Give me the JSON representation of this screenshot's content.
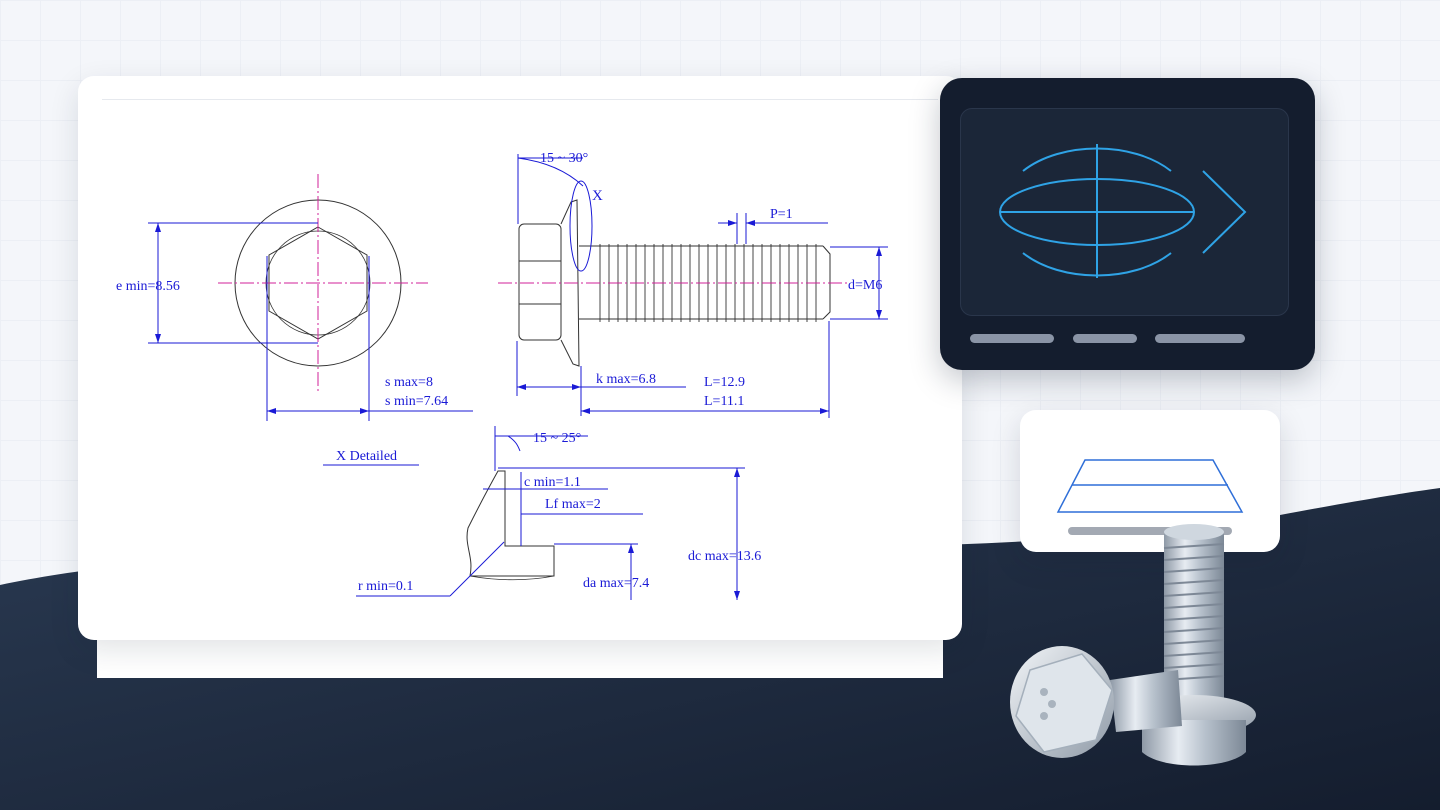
{
  "drawing": {
    "angle_head": "15 ~ 30°",
    "detail_marker": "X",
    "pitch": "P=1",
    "e_min": "e min=8.56",
    "thread_dia": "d=M6",
    "s_max": "s max=8",
    "s_min": "s min=7.64",
    "k_max": "k max=6.8",
    "l_max": "L=12.9",
    "l_min": "L=11.1",
    "detail_title": "X Detailed",
    "angle_flange": "15 ~ 25°",
    "c_min": "c min=1.1",
    "lf_max": "Lf max=2",
    "dc_max": "dc max=13.6",
    "da_max": "da max=7.4",
    "r_min": "r min=0.1"
  },
  "colors": {
    "dimension_blue": "#1a1ad6",
    "centerline_magenta": "#d0209a",
    "outline": "#333333",
    "dark_panel": "#141d2e",
    "accent_cyan": "#2fa3e6"
  },
  "icons": {
    "screen": "thread-profile-icon",
    "small_card": "trapezoid-layers-icon",
    "photo": "flange-bolt-photo"
  }
}
